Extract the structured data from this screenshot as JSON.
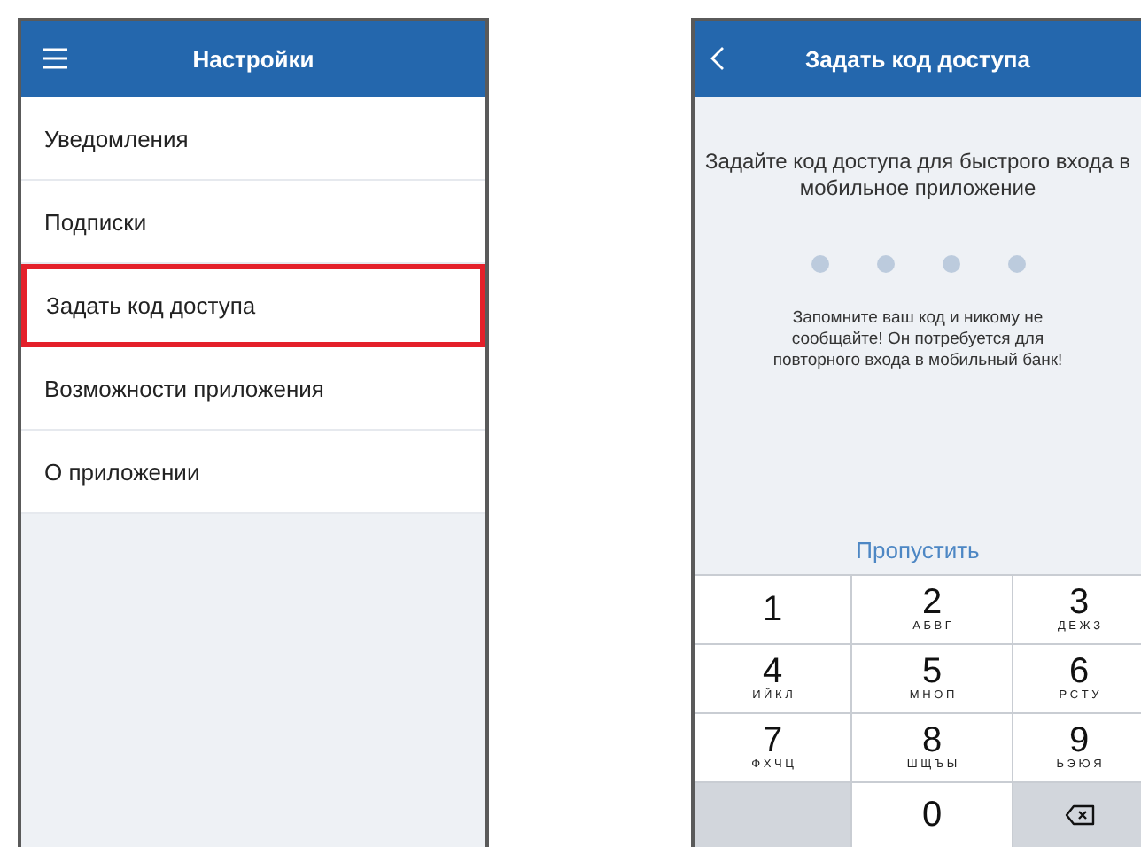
{
  "settings_screen": {
    "header": {
      "title": "Настройки"
    },
    "items": [
      {
        "label": "Уведомления",
        "highlighted": false
      },
      {
        "label": "Подписки",
        "highlighted": false
      },
      {
        "label": "Задать код доступа",
        "highlighted": true
      },
      {
        "label": "Возможности приложения",
        "highlighted": false
      },
      {
        "label": "О приложении",
        "highlighted": false
      }
    ]
  },
  "passcode_screen": {
    "header": {
      "title": "Задать код доступа"
    },
    "instruction": "Задайте код доступа для быстрого входа в мобильное приложение",
    "pin_dots": [
      {
        "filled": false
      },
      {
        "filled": false
      },
      {
        "filled": false
      },
      {
        "filled": false
      }
    ],
    "note": "Запомните ваш код и никому не сообщайте! Он потребуется для повторного входа в мобильный банк!",
    "skip_link": "Пропустить",
    "keypad": [
      {
        "kind": "digit",
        "digit": "1"
      },
      {
        "kind": "digit",
        "digit": "2",
        "letters": "А Б В Г"
      },
      {
        "kind": "digit",
        "digit": "3",
        "letters": "Д Е Ж З"
      },
      {
        "kind": "digit",
        "digit": "4",
        "letters": "И Й К Л"
      },
      {
        "kind": "digit",
        "digit": "5",
        "letters": "М Н О П"
      },
      {
        "kind": "digit",
        "digit": "6",
        "letters": "Р С Т У"
      },
      {
        "kind": "digit",
        "digit": "7",
        "letters": "Ф Х Ч Ц"
      },
      {
        "kind": "digit",
        "digit": "8",
        "letters": "Ш Щ Ъ Ы"
      },
      {
        "kind": "digit",
        "digit": "9",
        "letters": "Ь Э Ю Я"
      },
      {
        "kind": "blank"
      },
      {
        "kind": "digit",
        "digit": "0"
      },
      {
        "kind": "backspace"
      }
    ]
  }
}
